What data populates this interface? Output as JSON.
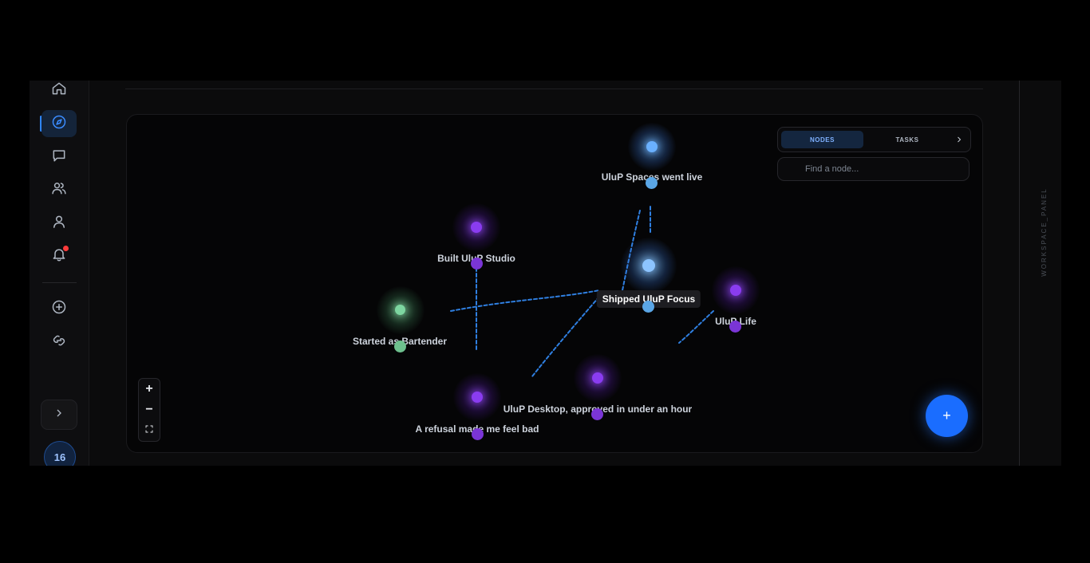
{
  "sidebar": {
    "items": [
      {
        "name": "home-icon"
      },
      {
        "name": "compass-icon",
        "active": true
      },
      {
        "name": "message-icon"
      },
      {
        "name": "users-icon"
      },
      {
        "name": "user-icon"
      },
      {
        "name": "bell-icon",
        "has_notification": true
      },
      {
        "name": "plus-circle-icon"
      },
      {
        "name": "link-icon"
      }
    ],
    "expand_icon": "chevron-right-icon",
    "badge_count": "16"
  },
  "panel": {
    "tabs": [
      {
        "label": "NODES",
        "active": true
      },
      {
        "label": "TASKS",
        "active": false
      }
    ],
    "search_placeholder": "Find a node..."
  },
  "graph": {
    "nodes": [
      {
        "id": "spaces",
        "label": "UluP Spaces went live",
        "color": "#6ab0ff",
        "kind": "blue"
      },
      {
        "id": "studio",
        "label": "Built UluP Studio",
        "color": "#8a3cf0",
        "kind": "purple"
      },
      {
        "id": "focus",
        "label": "Shipped UluP Focus",
        "color": "#6ab0ff",
        "kind": "blue",
        "highlighted": true
      },
      {
        "id": "life",
        "label": "UluP Life",
        "color": "#8a3cf0",
        "kind": "purple"
      },
      {
        "id": "bartender",
        "label": "Started as Bartender",
        "color": "#7dd6a0",
        "kind": "green"
      },
      {
        "id": "desktop",
        "label": "UluP Desktop, approved in under an hour",
        "color": "#8a3cf0",
        "kind": "purple"
      },
      {
        "id": "refusal",
        "label": "A refusal made me feel bad",
        "color": "#8a3cf0",
        "kind": "purple"
      }
    ],
    "link_color": "#2f7fe0"
  },
  "zoom": {
    "in_label": "+",
    "out_label": "−"
  },
  "fab": {
    "label": "+"
  },
  "right_panel": {
    "label": "WORKSPACE_PANEL"
  },
  "colors": {
    "accent": "#1a6dff",
    "background": "#050506"
  }
}
